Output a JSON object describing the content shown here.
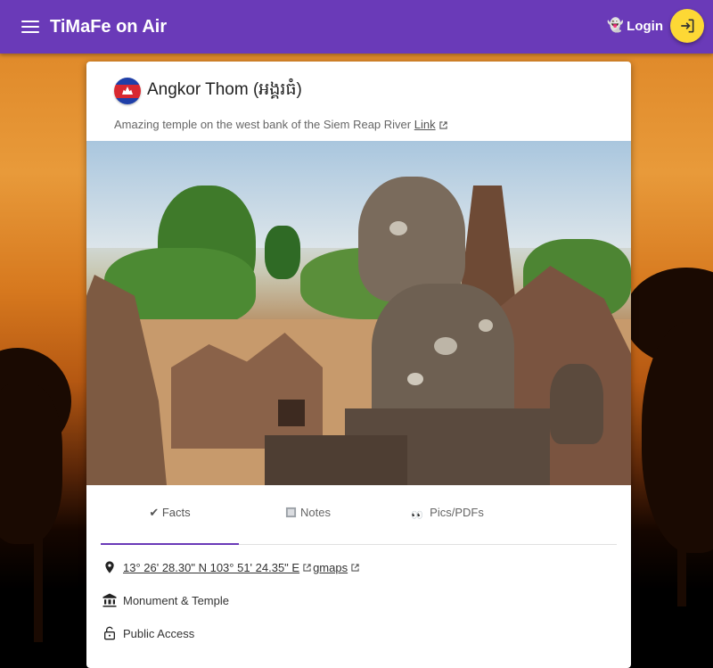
{
  "app": {
    "title": "TiMaFe on Air",
    "login_label": "Login"
  },
  "place": {
    "title": "Angkor Thom (អង្គរធំ)",
    "description": "Amazing temple on the west bank of the Siem Reap River",
    "link_label": "Link"
  },
  "tabs": [
    {
      "label": "✔ Facts"
    },
    {
      "label": "Notes"
    },
    {
      "label": "Pics/PDFs"
    }
  ],
  "facts": {
    "coordinates": "13° 26' 28.30\" N 103° 51' 24.35\" E",
    "gmaps_label": "gmaps",
    "category": "Monument & Temple",
    "access": "Public Access"
  },
  "colors": {
    "primary": "#6a3ab8",
    "accent": "#fdd835"
  },
  "icons": [
    "menu-icon",
    "ghost-icon",
    "login-icon",
    "flag-icon",
    "external-link-icon",
    "notes-icon",
    "eyes-icon",
    "location-pin-icon",
    "monument-icon",
    "lock-open-icon"
  ]
}
